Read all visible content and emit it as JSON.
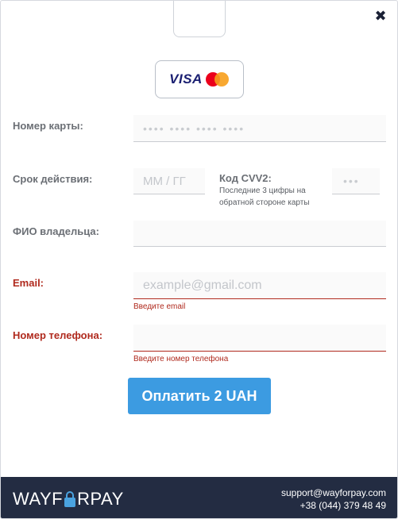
{
  "logos": {
    "visa_text": "VISA"
  },
  "form": {
    "card_number": {
      "label": "Номер карты:",
      "placeholder": "•••• •••• •••• ••••"
    },
    "expiry": {
      "label": "Срок действия:",
      "placeholder": "ММ / ГГ"
    },
    "cvv": {
      "label": "Код CVV2:",
      "hint_line1": "Последние 3 цифры на",
      "hint_line2": "обратной стороне карты",
      "placeholder": "•••"
    },
    "holder": {
      "label": "ФИО владельца:",
      "placeholder": ""
    },
    "email": {
      "label": "Email:",
      "placeholder": "example@gmail.com",
      "error": "Введите email"
    },
    "phone": {
      "label": "Номер телефона:",
      "placeholder": "",
      "error": "Введите номер телефона"
    }
  },
  "pay_button": {
    "label": "Оплатить 2 UAH"
  },
  "footer": {
    "brand_left": "WAYF",
    "brand_right": "RPAY",
    "email": "support@wayforpay.com",
    "phone": "+38 (044) 379 48 49"
  },
  "colors": {
    "accent": "#3c9be1",
    "error": "#b02a1e",
    "footer_bg": "#232c42"
  }
}
